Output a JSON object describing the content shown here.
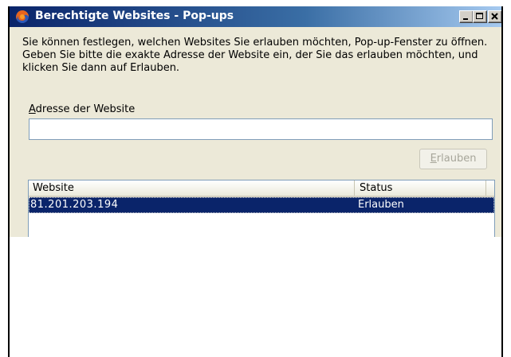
{
  "window": {
    "title": "Berechtigte Websites - Pop-ups",
    "title_gradient": [
      "#0a246a",
      "#a6caf0"
    ],
    "face_color": "#ece9d8"
  },
  "description": "Sie können festlegen, welchen Websites Sie erlauben möchten, Pop-up-Fenster zu öffnen. Geben Sie bitte die exakte Adresse der Website ein, der Sie das erlauben möchten, und klicken Sie dann auf Erlauben.",
  "address": {
    "label_accesskey": "A",
    "label_rest": "dresse der Website",
    "value": ""
  },
  "allow_button": {
    "accesskey": "E",
    "label_rest": "rlauben",
    "enabled": false
  },
  "list": {
    "columns": [
      "Website",
      "Status"
    ],
    "rows": [
      {
        "website": "81.201.203.194",
        "status": "Erlauben",
        "selected": true
      }
    ],
    "selection_color": "#0a246a"
  },
  "icons": {
    "app": "firefox-icon",
    "minimize": "minimize-icon",
    "maximize": "maximize-icon",
    "close": "close-icon"
  }
}
